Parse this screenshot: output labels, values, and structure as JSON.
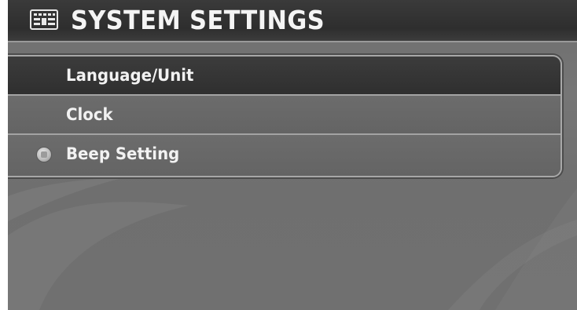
{
  "header": {
    "title": "SYSTEM SETTINGS",
    "icon": "keyboard-settings-icon"
  },
  "menu": {
    "items": [
      {
        "label": "Language/Unit",
        "highlighted": true,
        "indicator": false
      },
      {
        "label": "Clock",
        "highlighted": false,
        "indicator": false
      },
      {
        "label": "Beep Setting",
        "highlighted": false,
        "indicator": true
      }
    ]
  },
  "colors": {
    "header_bg": "#333333",
    "highlight_bg": "#353535",
    "item_bg": "#686868",
    "text": "#f2f2f2",
    "border": "#a8a8a8"
  }
}
